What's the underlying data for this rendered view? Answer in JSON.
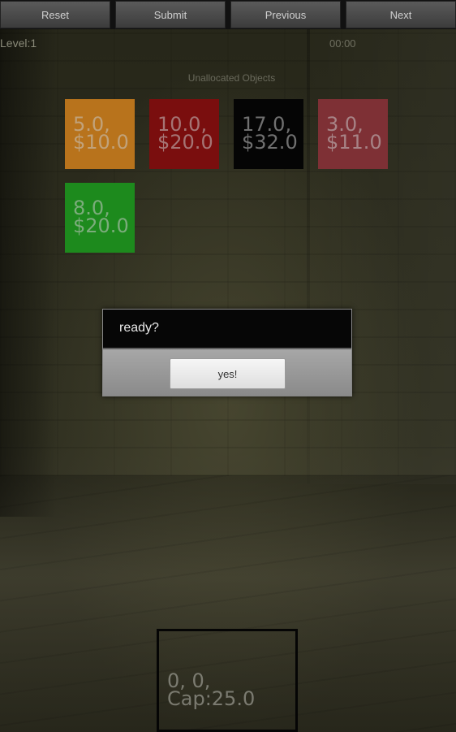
{
  "toolbar": {
    "reset_label": "Reset",
    "submit_label": "Submit",
    "previous_label": "Previous",
    "next_label": "Next"
  },
  "status": {
    "level": "Level:1",
    "timer": "00:00"
  },
  "unallocated": {
    "title": "Unallocated Objects",
    "items": [
      {
        "weight": "5.0,",
        "value": "$10.0",
        "color": "#b8731c"
      },
      {
        "weight": "10.0,",
        "value": "$20.0",
        "color": "#7a0e0e"
      },
      {
        "weight": "17.0,",
        "value": "$32.0",
        "color": "#050505"
      },
      {
        "weight": "3.0,",
        "value": "$11.0",
        "color": "#7e3035"
      },
      {
        "weight": "8.0,",
        "value": "$20.0",
        "color": "#1d8a1d"
      }
    ]
  },
  "dialog": {
    "message": "ready?",
    "confirm_label": "yes!"
  },
  "knapsack": {
    "contents": "0, 0,",
    "capacity": "Cap:25.0"
  }
}
